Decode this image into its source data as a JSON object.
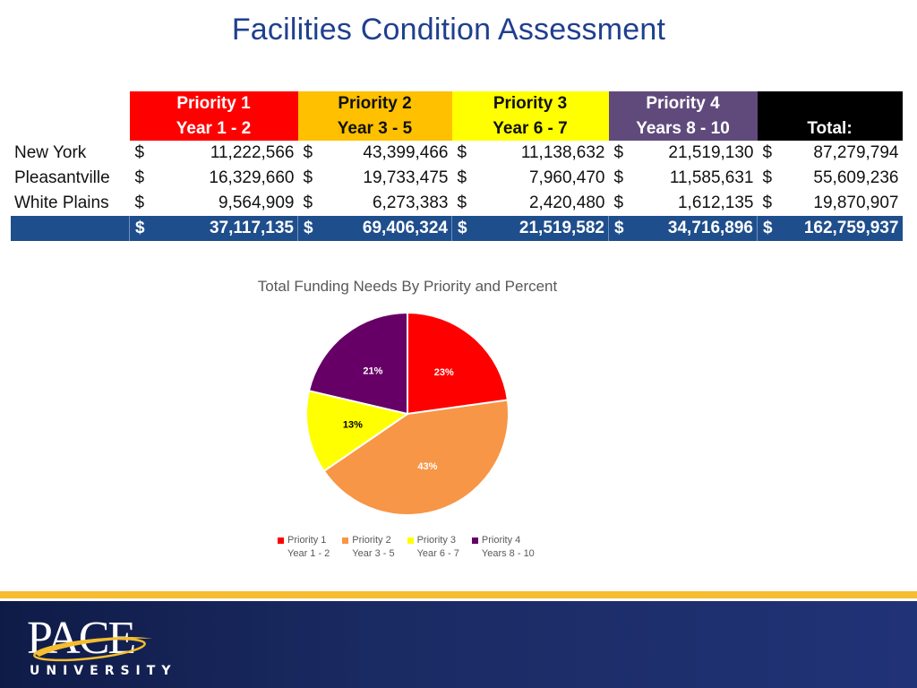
{
  "title": "Facilities Condition Assessment",
  "table": {
    "headers": [
      {
        "line1": "Priority 1",
        "line2": "Year 1 - 2"
      },
      {
        "line1": "Priority 2",
        "line2": "Year 3 - 5"
      },
      {
        "line1": "Priority 3",
        "line2": "Year 6 - 7"
      },
      {
        "line1": "Priority 4",
        "line2": "Years 8 - 10"
      },
      {
        "line1": "",
        "line2": "Total:"
      }
    ],
    "currency": "$",
    "rows": [
      {
        "label": "New York",
        "values": [
          "11,222,566",
          "43,399,466",
          "11,138,632",
          "21,519,130",
          "87,279,794"
        ]
      },
      {
        "label": "Pleasantville",
        "values": [
          "16,329,660",
          "19,733,475",
          "7,960,470",
          "11,585,631",
          "55,609,236"
        ]
      },
      {
        "label": "White Plains",
        "values": [
          "9,564,909",
          "6,273,383",
          "2,420,480",
          "1,612,135",
          "19,870,907"
        ]
      }
    ],
    "totals": {
      "label": "",
      "values": [
        "37,117,135",
        "69,406,324",
        "21,519,582",
        "34,716,896",
        "162,759,937"
      ]
    },
    "colors": {
      "p1": "#ff0000",
      "p2": "#ffc000",
      "p3": "#ffff00",
      "p4": "#604a7b",
      "total": "#000000",
      "total_row": "#1f4e8c"
    }
  },
  "chart_data": {
    "type": "pie",
    "title": "Total Funding Needs By Priority and Percent",
    "categories": [
      "Priority 1 Year 1 - 2",
      "Priority 2 Year 3 - 5",
      "Priority 3 Year 6 - 7",
      "Priority 4 Years 8 - 10"
    ],
    "values": [
      37117135,
      69406324,
      21519582,
      34716896
    ],
    "labels": [
      "23%",
      "43%",
      "13%",
      "21%"
    ],
    "colors": [
      "#ff0000",
      "#f79646",
      "#ffff00",
      "#660066"
    ],
    "label_colors": [
      "#ffffff",
      "#ffffff",
      "#000000",
      "#ffffff"
    ],
    "legend": [
      {
        "line1": "Priority 1",
        "line2": "Year 1 - 2"
      },
      {
        "line1": "Priority 2",
        "line2": "Year 3 - 5"
      },
      {
        "line1": "Priority 3",
        "line2": "Year 6 - 7"
      },
      {
        "line1": "Priority 4",
        "line2": "Years 8 - 10"
      }
    ],
    "legend_position": "bottom"
  },
  "footer": {
    "logo_word": "PACE",
    "logo_sub": "UNIVERSITY",
    "accent_color": "#f5bd2f",
    "background_color": "#1a2a62"
  }
}
